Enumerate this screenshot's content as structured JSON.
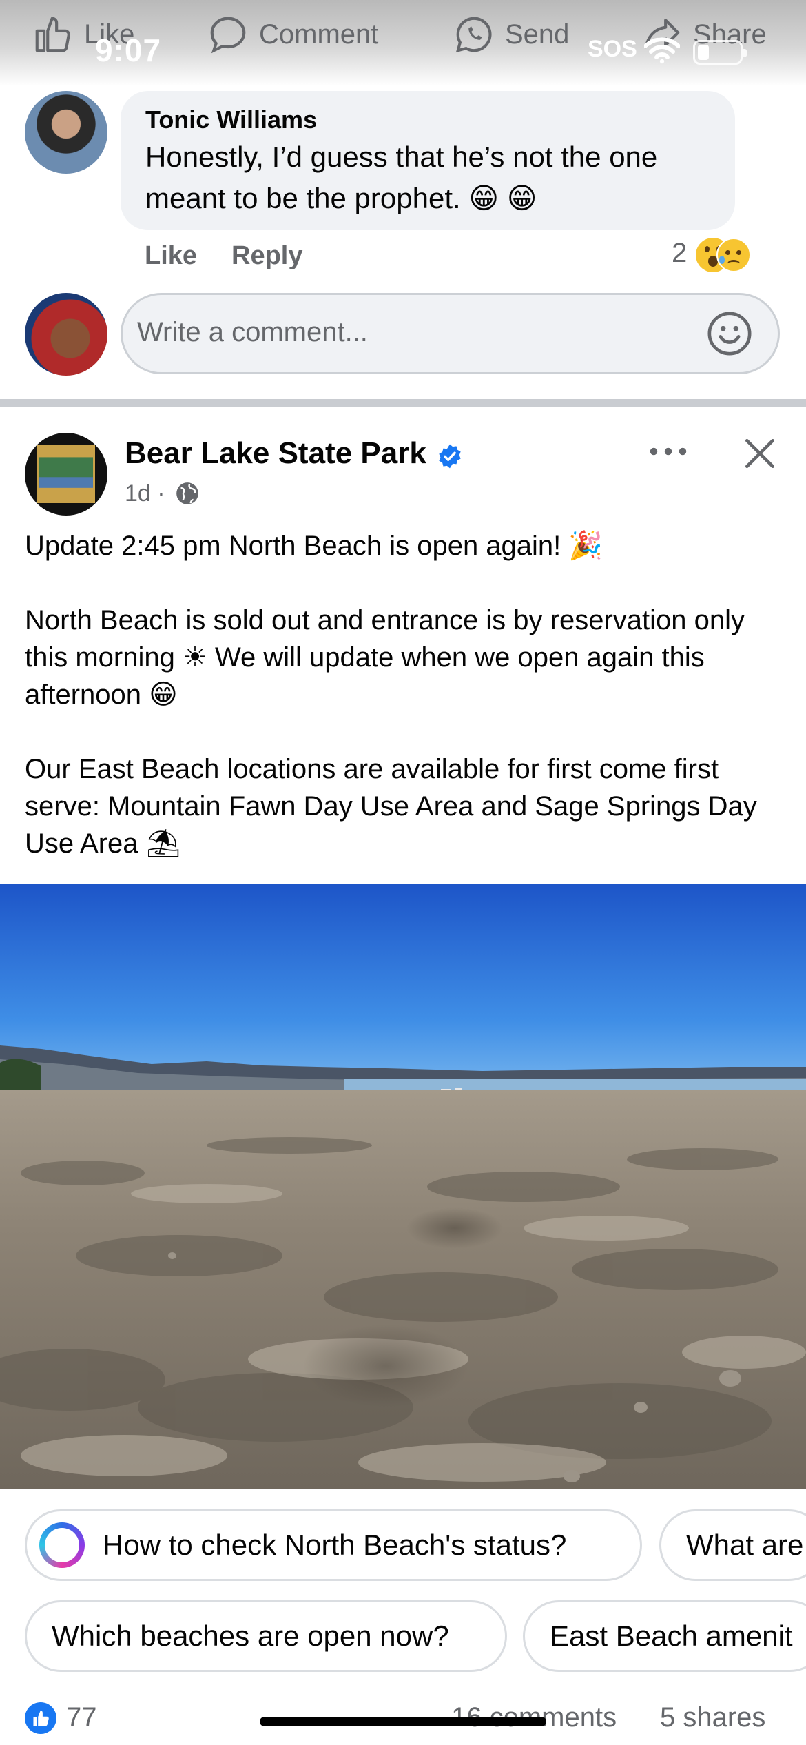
{
  "status_bar": {
    "time": "9:07",
    "sos": "SOS",
    "battery_level": 0.28
  },
  "action_bar": {
    "like": "Like",
    "comment": "Comment",
    "send": "Send",
    "share": "Share"
  },
  "comment": {
    "author": "Tonic Williams",
    "text": "Honestly, I’d guess that he’s not the one meant to be the prophet.",
    "text_emojis": [
      "grinning-face",
      "grinning-face"
    ],
    "like_label": "Like",
    "reply_label": "Reply",
    "reaction_count": "2",
    "reactions": [
      "wow",
      "sad"
    ]
  },
  "write_comment": {
    "placeholder": "Write a comment..."
  },
  "post": {
    "page_name": "Bear Lake State Park",
    "verified": true,
    "time_ago": "1d",
    "audience": "globe-icon",
    "body": "Update 2:45 pm North Beach is open again! 🎉\n\nNorth Beach is sold out and entrance is by reservation only this morning ☀ We will update when we open again this afternoon 😁\n\nOur East Beach locations are available for first come first serve: Mountain Fawn Day Use Area and Sage Springs Day Use Area ⛱"
  },
  "suggestions": [
    {
      "label": "How to check North Beach's status?"
    },
    {
      "label": "What are"
    },
    {
      "label": "Which beaches are open now?"
    },
    {
      "label": "East Beach amenit"
    }
  ],
  "footer": {
    "reactions": "77",
    "comments": "16 comments",
    "shares": "5 shares"
  },
  "colors": {
    "accent": "#1877f2",
    "muted": "#65676b",
    "bubble": "#f0f2f5"
  }
}
